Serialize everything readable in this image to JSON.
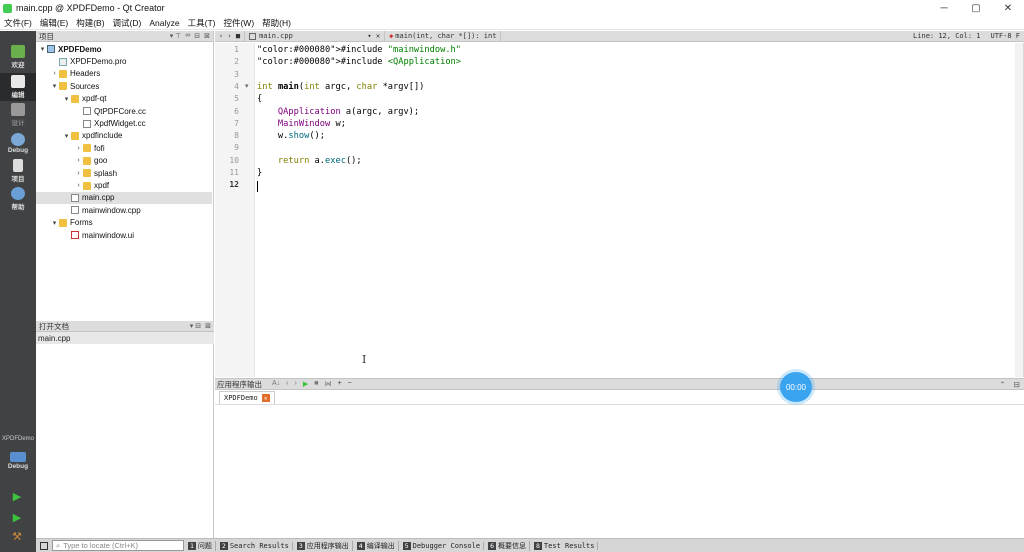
{
  "window": {
    "title": "main.cpp @ XPDFDemo - Qt Creator",
    "controls": [
      "─",
      "▢",
      "✕"
    ]
  },
  "menu": [
    "文件(F)",
    "编辑(E)",
    "构建(B)",
    "调试(D)",
    "Analyze",
    "工具(T)",
    "控件(W)",
    "帮助(H)"
  ],
  "modes": [
    {
      "label": "欢迎",
      "icon": "welcome-icon"
    },
    {
      "label": "编辑",
      "icon": "edit-icon"
    },
    {
      "label": "设计",
      "icon": "design-icon"
    },
    {
      "label": "Debug",
      "icon": "debug-icon"
    },
    {
      "label": "项目",
      "icon": "projects-icon"
    },
    {
      "label": "帮助",
      "icon": "help-icon"
    }
  ],
  "kit": {
    "project": "XPDFDemo",
    "config": "Debug"
  },
  "project_pane": {
    "title": "项目",
    "tree": [
      {
        "label": "XPDFDemo",
        "depth": 0,
        "arrow": "▾",
        "icon": "project"
      },
      {
        "label": "XPDFDemo.pro",
        "depth": 1,
        "arrow": "",
        "icon": "pro"
      },
      {
        "label": "Headers",
        "depth": 1,
        "arrow": "›",
        "icon": "folder"
      },
      {
        "label": "Sources",
        "depth": 1,
        "arrow": "▾",
        "icon": "folder"
      },
      {
        "label": "xpdf-qt",
        "depth": 2,
        "arrow": "▾",
        "icon": "folder"
      },
      {
        "label": "QtPDFCore.cc",
        "depth": 3,
        "arrow": "",
        "icon": "cpp"
      },
      {
        "label": "XpdfWidget.cc",
        "depth": 3,
        "arrow": "",
        "icon": "cpp"
      },
      {
        "label": "xpdfinclude",
        "depth": 2,
        "arrow": "▾",
        "icon": "folder"
      },
      {
        "label": "fofi",
        "depth": 3,
        "arrow": "›",
        "icon": "folder"
      },
      {
        "label": "goo",
        "depth": 3,
        "arrow": "›",
        "icon": "folder"
      },
      {
        "label": "splash",
        "depth": 3,
        "arrow": "›",
        "icon": "folder"
      },
      {
        "label": "xpdf",
        "depth": 3,
        "arrow": "›",
        "icon": "folder"
      },
      {
        "label": "main.cpp",
        "depth": 2,
        "arrow": "",
        "icon": "cpp",
        "selected": true
      },
      {
        "label": "mainwindow.cpp",
        "depth": 2,
        "arrow": "",
        "icon": "cpp"
      },
      {
        "label": "Forms",
        "depth": 1,
        "arrow": "▾",
        "icon": "folder"
      },
      {
        "label": "mainwindow.ui",
        "depth": 2,
        "arrow": "",
        "icon": "ui"
      }
    ]
  },
  "open_docs": {
    "title": "打开文档",
    "items": [
      "main.cpp"
    ]
  },
  "editor": {
    "tab": "main.cpp",
    "symbol": "main(int, char *[]): int",
    "position": "Line: 12, Col: 1",
    "encoding": "UTF-8 F",
    "lines": [
      "#include \"mainwindow.h\"",
      "#include <QApplication>",
      "",
      "int main(int argc, char *argv[])",
      "{",
      "    QApplication a(argc, argv);",
      "    MainWindow w;",
      "    w.show();",
      "",
      "    return a.exec();",
      "}",
      ""
    ],
    "line_numbers": [
      "1",
      "2",
      "3",
      "4",
      "5",
      "6",
      "7",
      "8",
      "9",
      "10",
      "11",
      "12"
    ],
    "current_line": 12
  },
  "output": {
    "title": "应用程序输出",
    "tab": "XPDFDemo",
    "timer": "00:00"
  },
  "statusbar": {
    "locator_placeholder": "Type to locate (Ctrl+K)",
    "tabs": [
      {
        "num": "1",
        "label": "问题"
      },
      {
        "num": "2",
        "label": "Search Results"
      },
      {
        "num": "3",
        "label": "应用程序输出"
      },
      {
        "num": "4",
        "label": "编译输出"
      },
      {
        "num": "5",
        "label": "Debugger Console"
      },
      {
        "num": "6",
        "label": "概要信息"
      },
      {
        "num": "8",
        "label": "Test Results"
      }
    ]
  },
  "colors": {
    "keyword": "#808000",
    "string": "#008000",
    "type": "#800080",
    "func": "#00677c",
    "modebar": "#404244"
  }
}
